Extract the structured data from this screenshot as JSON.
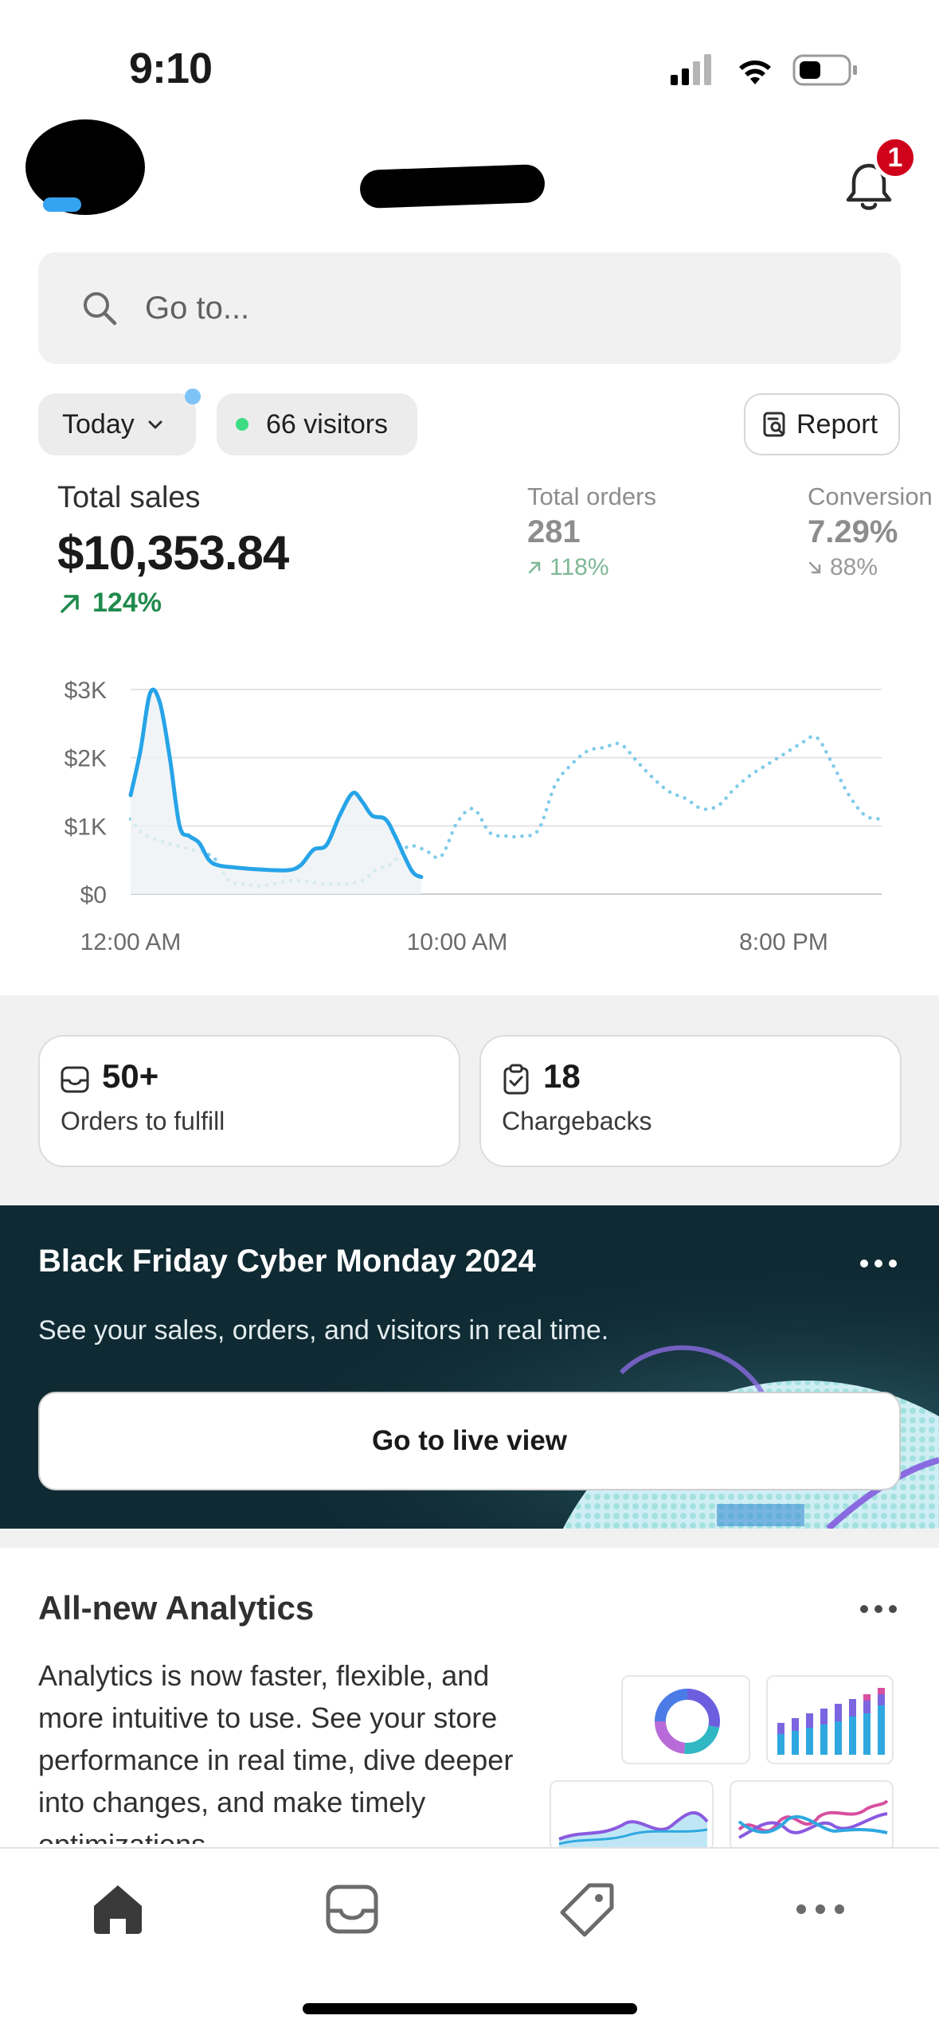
{
  "status_bar": {
    "time": "9:10"
  },
  "header": {
    "notification_count": "1"
  },
  "search": {
    "placeholder": "Go to..."
  },
  "filters": {
    "date_range": "Today",
    "visitors": "66 visitors",
    "report_label": "Report"
  },
  "metrics": {
    "total_sales": {
      "label": "Total sales",
      "value": "$10,353.84",
      "change": "124%"
    },
    "total_orders": {
      "label": "Total orders",
      "value": "281",
      "change": "118%"
    },
    "conversion": {
      "label": "Conversion",
      "value": "7.29%",
      "change": "88%"
    }
  },
  "chart_data": {
    "type": "line",
    "title": "",
    "xlabel": "",
    "ylabel": "",
    "x_tick_labels": [
      "12:00 AM",
      "10:00 AM",
      "8:00 PM"
    ],
    "y_tick_labels": [
      "$0",
      "$1K",
      "$2K",
      "$3K"
    ],
    "ylim": [
      0,
      3000
    ],
    "x_unit": "hour of day",
    "grid": true,
    "colors": {
      "today": "#27a4e8",
      "comparison": "#7fcbea"
    },
    "series": [
      {
        "style": "solid",
        "x": [
          0,
          0.3,
          0.6,
          0.9,
          1.2,
          1.5,
          1.8,
          2.1,
          2.4,
          2.7,
          3.2,
          4.0,
          4.8,
          5.2,
          5.6,
          6.0,
          6.4,
          6.8,
          7.1,
          7.4,
          7.8,
          8.1,
          8.6,
          8.9
        ],
        "y": [
          1450,
          2100,
          2950,
          2800,
          2000,
          1000,
          850,
          750,
          500,
          420,
          390,
          360,
          350,
          420,
          650,
          720,
          1150,
          1480,
          1350,
          1150,
          1100,
          850,
          350,
          250
        ]
      },
      {
        "style": "dotted",
        "x": [
          0,
          0.5,
          1.5,
          2.5,
          3.0,
          3.5,
          4.0,
          5.0,
          6.0,
          7.0,
          7.5,
          8.0,
          8.5,
          9.0,
          9.5,
          10.0,
          10.5,
          11.0,
          11.5,
          12.0,
          12.5,
          13.0,
          13.5,
          14.0,
          14.5,
          15.0,
          15.5,
          16.0,
          16.5,
          17.0,
          17.5,
          18.0,
          18.5,
          19.0,
          19.5,
          20.0,
          20.5,
          21.0,
          21.5,
          22.0,
          22.5,
          23.0
        ],
        "y": [
          1100,
          850,
          700,
          550,
          200,
          150,
          120,
          200,
          150,
          180,
          350,
          450,
          700,
          650,
          550,
          1050,
          1250,
          900,
          850,
          850,
          950,
          1600,
          1900,
          2100,
          2150,
          2200,
          1950,
          1700,
          1500,
          1400,
          1250,
          1300,
          1550,
          1750,
          1900,
          2050,
          2200,
          2300,
          1900,
          1450,
          1150,
          1100
        ]
      }
    ]
  },
  "quick_cards": [
    {
      "value": "50+",
      "label": "Orders to fulfill"
    },
    {
      "value": "18",
      "label": "Chargebacks"
    }
  ],
  "bfcm_banner": {
    "title": "Black Friday Cyber Monday 2024",
    "description": "See your sales, orders, and visitors in real time.",
    "button_label": "Go to live view"
  },
  "analytics_card": {
    "title": "All-new Analytics",
    "body": "Analytics is now faster, flexible, and more intuitive to use. See your store performance in real time, dive deeper into changes, and make timely optimizations."
  },
  "bottom_nav": {
    "items": [
      "home-icon",
      "orders-inbox-icon",
      "products-tag-icon",
      "more-icon"
    ],
    "active": "home-icon"
  }
}
